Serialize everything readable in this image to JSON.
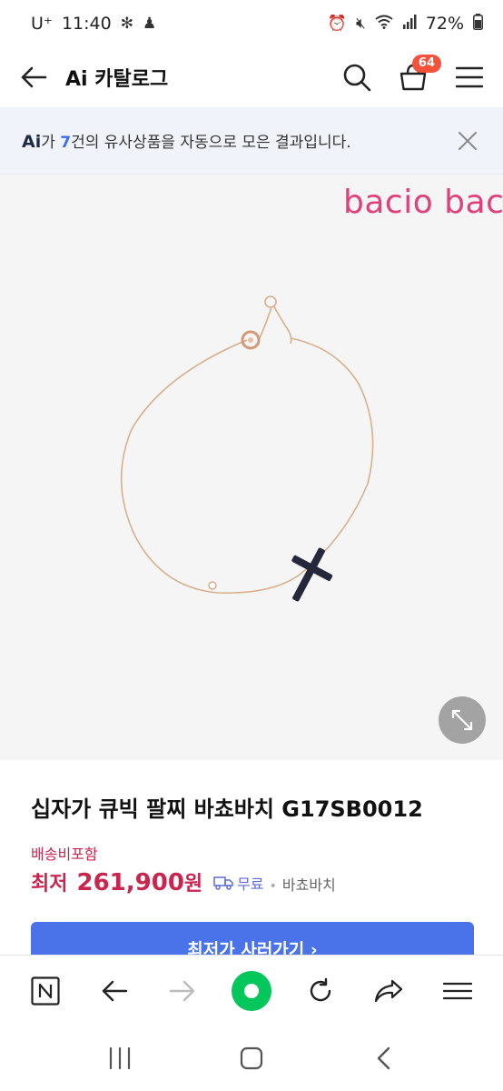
{
  "status_bar": {
    "carrier": "U⁺",
    "time": "11:40",
    "battery": "72%"
  },
  "header": {
    "title": "Ai 카탈로그",
    "cart_count": "64"
  },
  "ai_notice": {
    "mark": "Ai",
    "prefix": "가 ",
    "count": "7",
    "suffix": "건의 유사상품을 자동으로 모은 결과입니다."
  },
  "product_image": {
    "brand_watermark": "bacio bacio"
  },
  "product": {
    "name": "십자가 큐빅 팔찌 바쵸바치 G17SB0012",
    "shipping_note": "배송비포함",
    "price_label": "최저",
    "price": "261,900",
    "price_unit": "원",
    "shipping_fee": "무료",
    "seller": "바쵸바치",
    "buy_button": "최저가 사러가기 ›"
  },
  "colors": {
    "accent_price": "#c9254f",
    "button_blue": "#4a73ea",
    "naver_green": "#03c75a",
    "badge": "#f4523b"
  },
  "icons": {
    "back": "arrow-left-icon",
    "search": "search-icon",
    "cart": "cart-icon",
    "menu": "hamburger-menu-icon",
    "close": "close-icon",
    "expand": "expand-icon"
  }
}
